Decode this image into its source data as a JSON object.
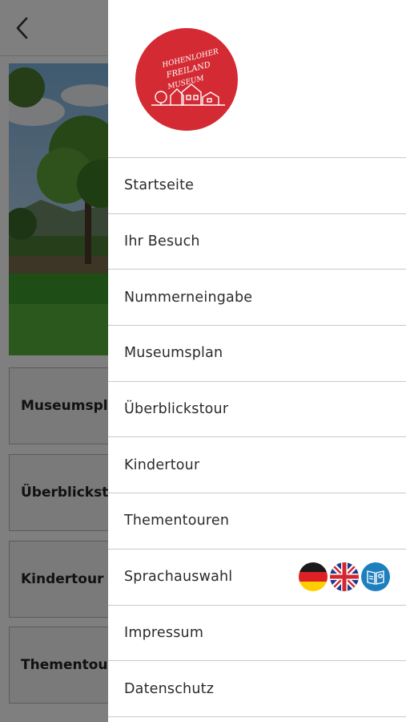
{
  "background": {
    "back_icon": "chevron-left-icon",
    "tiles": [
      {
        "label": "Museumsplan"
      },
      {
        "label": "Überblickstour"
      },
      {
        "label": "Kindertour"
      },
      {
        "label": "Thementouren"
      }
    ]
  },
  "drawer": {
    "logo": {
      "text_lines": [
        "HOHENLOHER",
        "FREILAND",
        "MUSEUM"
      ],
      "color": "#d42a33"
    },
    "menu": [
      {
        "label": "Startseite"
      },
      {
        "label": "Ihr Besuch"
      },
      {
        "label": "Nummerneingabe"
      },
      {
        "label": "Museumsplan"
      },
      {
        "label": "Überblickstour"
      },
      {
        "label": "Kindertour"
      },
      {
        "label": "Thementouren"
      },
      {
        "label": "Sprachauswahl"
      },
      {
        "label": "Impressum"
      },
      {
        "label": "Datenschutz"
      }
    ],
    "language_flags": [
      "german-flag-icon",
      "uk-flag-icon",
      "easy-language-icon"
    ]
  }
}
